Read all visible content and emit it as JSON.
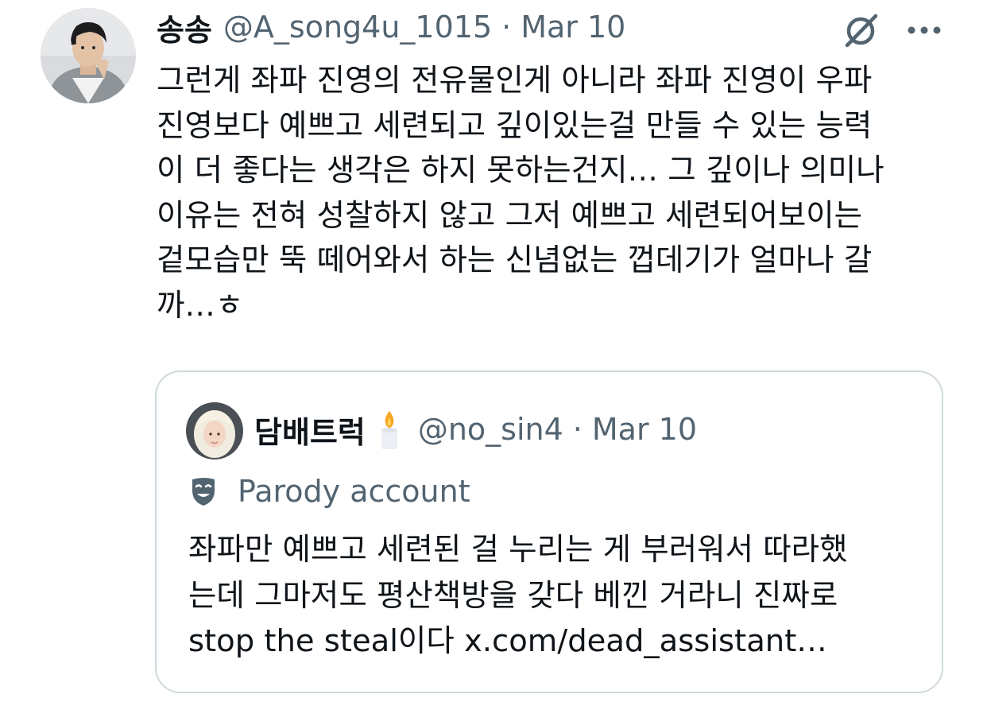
{
  "tweet": {
    "author": {
      "display_name": "송송",
      "handle": "@A_song4u_1015",
      "avatar_icon": "user-avatar-photo"
    },
    "separator": "·",
    "date": "Mar 10",
    "actions": {
      "grok_icon": "grok-icon",
      "more_icon": "more-horizontal-icon"
    },
    "text_lines": [
      "그런게 좌파 진영의 전유물인게 아니라 좌파 진영이 우파",
      "진영보다 예쁘고 세련되고 깊이있는걸 만들 수 있는 능력",
      "이 더 좋다는 생각은 하지 못하는건지… 그 깊이나 의미나",
      "이유는 전혀 성찰하지 않고 그저 예쁘고 세련되어보이는",
      "겉모습만 뚝 떼어와서 하는 신념없는 껍데기가 얼마나 갈",
      "까…ㅎ"
    ]
  },
  "quoted_tweet": {
    "author": {
      "display_name": "담배트럭",
      "emoji_icon": "candle-icon",
      "handle": "@no_sin4",
      "avatar_icon": "user-avatar-photo"
    },
    "separator": "·",
    "date": "Mar 10",
    "label": {
      "icon": "mask-icon",
      "text": "Parody account"
    },
    "text_lines": [
      "좌파만 예쁘고 세련된 걸 누리는 게 부러워서 따라했",
      "는데 그마저도 평산책방을 갖다 베낀 거라니 진짜로",
      "stop the steal이다 x.com/dead_assistant…"
    ]
  },
  "colors": {
    "primary_text": "#0f1419",
    "secondary_text": "#536471",
    "border": "#cfd9de"
  }
}
